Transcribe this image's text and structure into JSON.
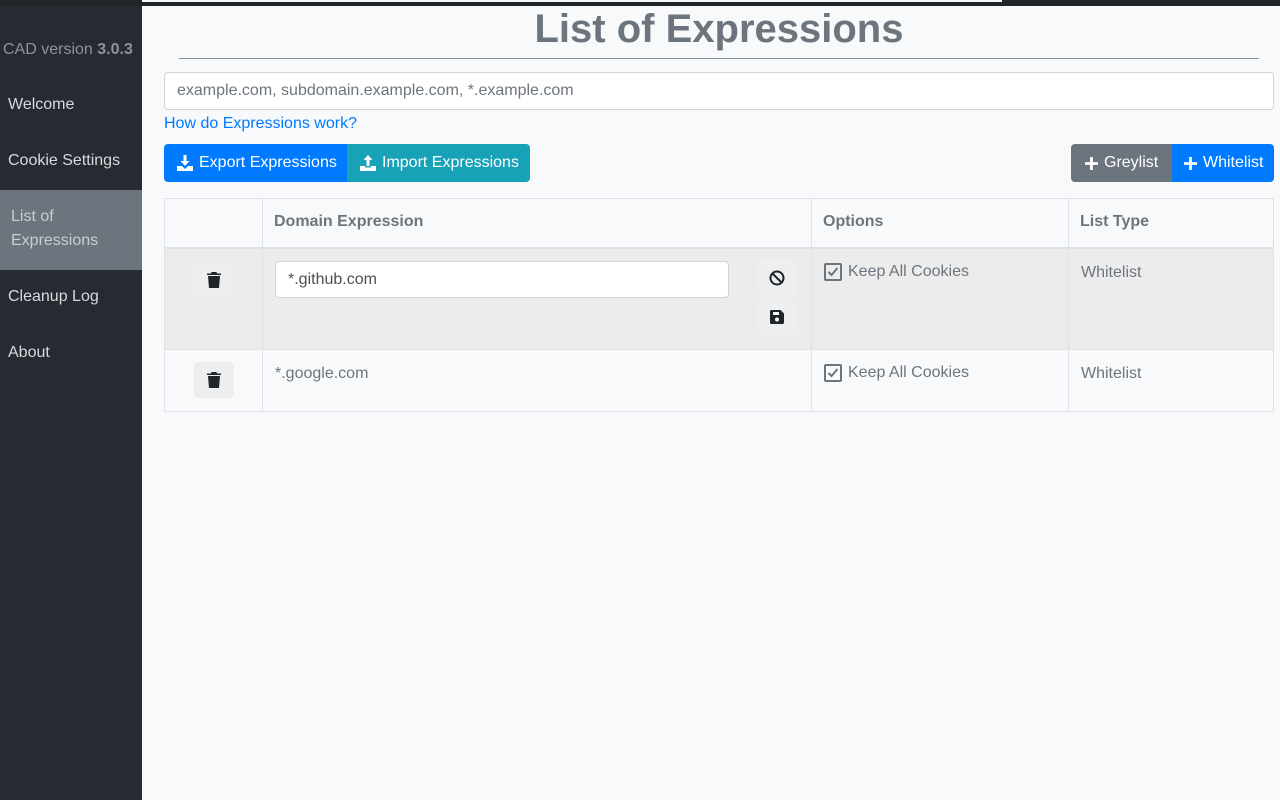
{
  "sidebar": {
    "version_prefix": "CAD version",
    "version_number": "3.0.3",
    "items": [
      {
        "label": "Welcome"
      },
      {
        "label": "Cookie Settings"
      },
      {
        "label": "List of Expressions"
      },
      {
        "label": "Cleanup Log"
      },
      {
        "label": "About"
      }
    ],
    "active_item": "List of Expressions"
  },
  "main": {
    "title": "List of Expressions",
    "input_placeholder": "example.com, subdomain.example.com, *.example.com",
    "help_link": "How do Expressions work?",
    "buttons": {
      "export": "Export Expressions",
      "import": "Import Expressions",
      "greylist": "Greylist",
      "whitelist": "Whitelist"
    },
    "table": {
      "headers": [
        "",
        "Domain Expression",
        "Options",
        "List Type"
      ],
      "rows": [
        {
          "domain": "*.github.com",
          "editing": true,
          "option_label": "Keep All Cookies",
          "option_checked": true,
          "list_type": "Whitelist"
        },
        {
          "domain": "*.google.com",
          "editing": false,
          "option_label": "Keep All Cookies",
          "option_checked": true,
          "list_type": "Whitelist"
        }
      ]
    }
  },
  "colors": {
    "sidebar_bg": "#262b32",
    "active_nav_bg": "#6c757d",
    "primary": "#007bff",
    "info": "#17a2b8",
    "secondary": "#6c757d"
  }
}
